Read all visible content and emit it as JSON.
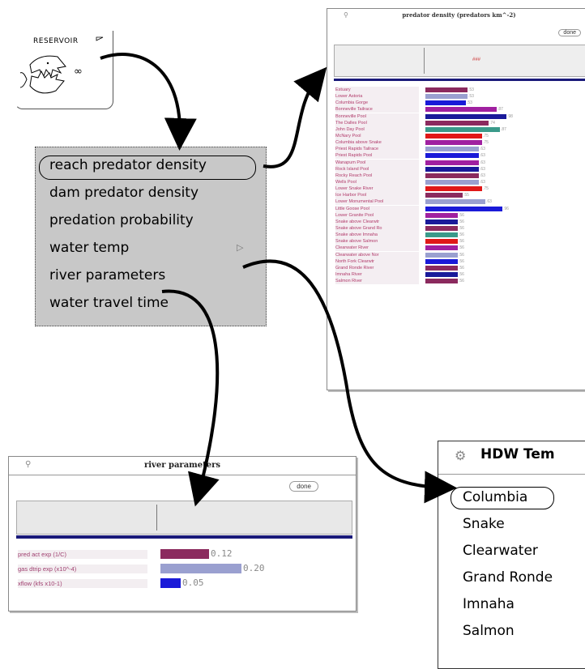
{
  "reservoir": {
    "label": "RESERVOIR",
    "icon": "fish-jaws-icon",
    "symbol": "∞"
  },
  "menu": {
    "items": [
      "reach predator density",
      "dam predator density",
      "predation probability",
      "water temp",
      "river parameters",
      "water travel time"
    ],
    "submenu_arrow": "▷"
  },
  "predator_window": {
    "title": "predator density (predators km^-2)",
    "done_label": "done",
    "column_label": "###",
    "rows": [
      {
        "name": "Estuary",
        "value": 0.52,
        "color": "#8b2a5e",
        "label": ".53"
      },
      {
        "name": "Lower Astoria",
        "value": 0.52,
        "color": "#9aa0d0",
        "label": ".53"
      },
      {
        "name": "Columbia Gorge",
        "value": 0.5,
        "color": "#1a1ad8",
        "label": ".53"
      },
      {
        "name": "Bonneville Tailrace",
        "value": 0.88,
        "color": "#a020a0",
        "label": ".87"
      },
      {
        "name": "Bonneville Pool",
        "value": 1.0,
        "color": "#1a1a9a",
        "label": ".98"
      },
      {
        "name": "The Dalles Pool",
        "value": 0.78,
        "color": "#8b2a5e",
        "label": ".74"
      },
      {
        "name": "John Day Pool",
        "value": 0.92,
        "color": "#3a9a8a",
        "label": ".87"
      },
      {
        "name": "McNary Pool",
        "value": 0.7,
        "color": "#e01818",
        "label": ".75"
      },
      {
        "name": "Columbia above Snake",
        "value": 0.7,
        "color": "#a020a0",
        "label": ".75"
      },
      {
        "name": "Priest Rapids Tailrace",
        "value": 0.66,
        "color": "#9aa0d0",
        "label": ".63"
      },
      {
        "name": "Priest Rapids Pool",
        "value": 0.66,
        "color": "#1a1ad8",
        "label": ".63"
      },
      {
        "name": "Wanapum Pool",
        "value": 0.66,
        "color": "#a020a0",
        "label": ".63"
      },
      {
        "name": "Rock Island Pool",
        "value": 0.66,
        "color": "#1a1a9a",
        "label": ".63"
      },
      {
        "name": "Rocky Reach Pool",
        "value": 0.66,
        "color": "#8b2a5e",
        "label": ".63"
      },
      {
        "name": "Wells Pool",
        "value": 0.66,
        "color": "#9aa0d0",
        "label": ".63"
      },
      {
        "name": "Lower Snake River",
        "value": 0.7,
        "color": "#e01818",
        "label": ".75"
      },
      {
        "name": "Ice Harbor Pool",
        "value": 0.46,
        "color": "#8b2a5e",
        "label": ".55"
      },
      {
        "name": "Lower Monumental Pool",
        "value": 0.74,
        "color": "#9aa0d0",
        "label": ".63"
      },
      {
        "name": "Little Goose Pool",
        "value": 0.95,
        "color": "#1a1ad8",
        "label": ".96"
      },
      {
        "name": "Lower Granite Pool",
        "value": 0.4,
        "color": "#a020a0",
        "label": ".56"
      },
      {
        "name": "Snake above Clearwtr",
        "value": 0.4,
        "color": "#1a1a9a",
        "label": ".56"
      },
      {
        "name": "Snake above Grand Ro",
        "value": 0.4,
        "color": "#8b2a5e",
        "label": ".56"
      },
      {
        "name": "Snake above Imnaha",
        "value": 0.4,
        "color": "#3a9a8a",
        "label": ".56"
      },
      {
        "name": "Snake above Salmon",
        "value": 0.4,
        "color": "#e01818",
        "label": ".56"
      },
      {
        "name": "Clearwater River",
        "value": 0.4,
        "color": "#a020a0",
        "label": ".56"
      },
      {
        "name": "Clearwater above Nor",
        "value": 0.4,
        "color": "#9aa0d0",
        "label": ".56"
      },
      {
        "name": "North Fork Clearwtr",
        "value": 0.4,
        "color": "#1a1ad8",
        "label": ".56"
      },
      {
        "name": "Grand Ronde River",
        "value": 0.4,
        "color": "#8b2a5e",
        "label": ".56"
      },
      {
        "name": "Imnaha River",
        "value": 0.4,
        "color": "#1a1a9a",
        "label": ".56"
      },
      {
        "name": "Salmon River",
        "value": 0.4,
        "color": "#8b2a5e",
        "label": ".56"
      }
    ]
  },
  "river_window": {
    "title": "river parameters",
    "done_label": "done",
    "rows": [
      {
        "name": "pred act exp (1/C)",
        "value": 0.12,
        "label": "0.12",
        "color": "#8b2a5e",
        "fill": 0.6
      },
      {
        "name": "gas dtrip exp (x10^-4)",
        "value": 0.2,
        "label": "0.20",
        "color": "#9aa0d0",
        "fill": 1.0
      },
      {
        "name": "xflow (kfs x10-1)",
        "value": 0.05,
        "label": "0.05",
        "color": "#1a1ad8",
        "fill": 0.25
      }
    ]
  },
  "hdw_window": {
    "title": "HDW Tem",
    "icon": "gear-icon",
    "items": [
      "Columbia",
      "Snake",
      "Clearwater",
      "Grand Ronde",
      "Imnaha",
      "Salmon"
    ]
  }
}
